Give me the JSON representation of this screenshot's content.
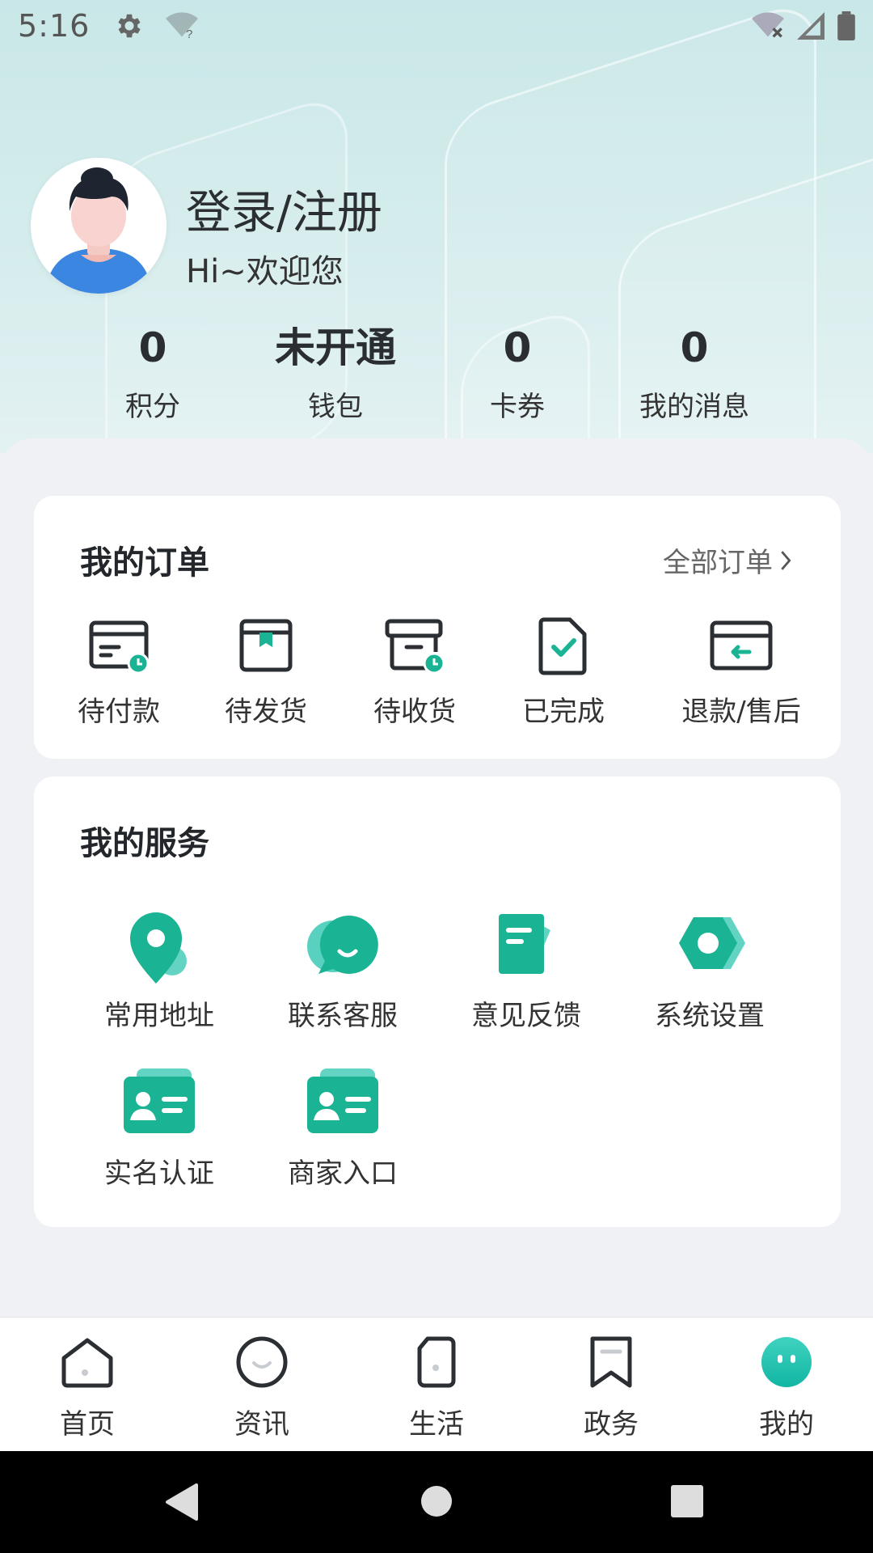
{
  "status_bar": {
    "time": "5:16"
  },
  "profile": {
    "login_label": "登录/注册",
    "welcome": "Hi~欢迎您"
  },
  "stats": [
    {
      "value": "0",
      "label": "积分"
    },
    {
      "value": "未开通",
      "label": "钱包"
    },
    {
      "value": "0",
      "label": "卡券"
    },
    {
      "value": "0",
      "label": "我的消息"
    }
  ],
  "orders": {
    "title": "我的订单",
    "all_label": "全部订单",
    "items": [
      {
        "label": "待付款",
        "icon": "pending-payment-icon"
      },
      {
        "label": "待发货",
        "icon": "pending-shipment-icon"
      },
      {
        "label": "待收货",
        "icon": "pending-receipt-icon"
      },
      {
        "label": "已完成",
        "icon": "completed-icon"
      },
      {
        "label": "退款/售后",
        "icon": "refund-icon"
      }
    ]
  },
  "services": {
    "title": "我的服务",
    "items": [
      {
        "label": "常用地址",
        "icon": "location-pin-icon"
      },
      {
        "label": "联系客服",
        "icon": "chat-icon"
      },
      {
        "label": "意见反馈",
        "icon": "feedback-icon"
      },
      {
        "label": "系统设置",
        "icon": "settings-icon"
      },
      {
        "label": "实名认证",
        "icon": "id-card-icon"
      },
      {
        "label": "商家入口",
        "icon": "merchant-card-icon"
      }
    ]
  },
  "bottom_nav": [
    {
      "label": "首页",
      "icon": "home-icon"
    },
    {
      "label": "资讯",
      "icon": "news-icon"
    },
    {
      "label": "生活",
      "icon": "life-icon"
    },
    {
      "label": "政务",
      "icon": "government-icon"
    },
    {
      "label": "我的",
      "icon": "profile-icon",
      "active": true
    }
  ],
  "colors": {
    "accent": "#1ab394",
    "accent_light": "#3cc9b5",
    "text_dark": "#23272b"
  }
}
